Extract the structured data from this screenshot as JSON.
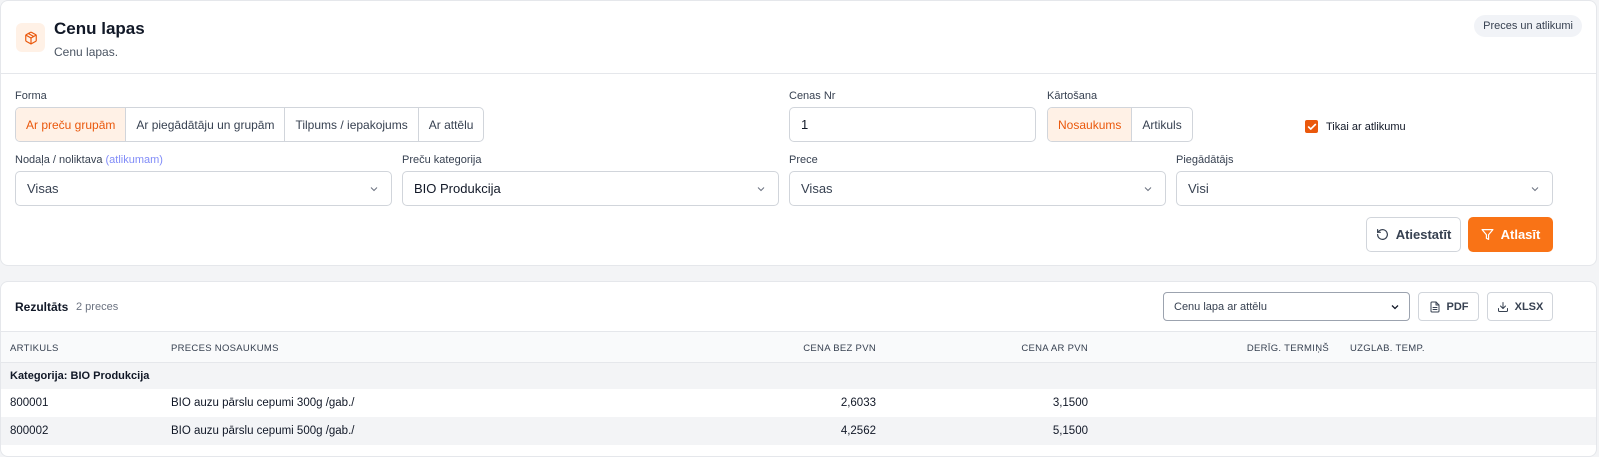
{
  "header": {
    "title": "Cenu lapas",
    "subtitle": "Cenu lapas.",
    "badge": "Preces un atlikumi",
    "icon": "package-icon"
  },
  "filters": {
    "forma": {
      "label": "Forma",
      "options": [
        "Ar preču grupām",
        "Ar piegādātāju un grupām",
        "Tilpums / iepakojums",
        "Ar attēlu"
      ],
      "active_index": 0
    },
    "cenas_nr": {
      "label": "Cenas Nr",
      "value": "1"
    },
    "kartosana": {
      "label": "Kārtošana",
      "options": [
        "Nosaukums",
        "Artikuls"
      ],
      "active_index": 0
    },
    "only_with_stock": {
      "label": "Tikai ar atlikumu",
      "checked": true
    },
    "nodala": {
      "label": "Nodaļa / noliktava",
      "label_hint": "(atlikumam)",
      "value": "Visas"
    },
    "kategorija": {
      "label": "Preču kategorija",
      "value": "BIO Produkcija"
    },
    "prece": {
      "label": "Prece",
      "value": "Visas"
    },
    "piegadatajs": {
      "label": "Piegādātājs",
      "value": "Visi"
    },
    "reset_label": "Atiestatīt",
    "search_label": "Atlasīt"
  },
  "results": {
    "title": "Rezultāts",
    "count": "2 preces",
    "export_format": "Cenu lapa ar attēlu",
    "pdf_label": "PDF",
    "xlsx_label": "XLSX",
    "columns": {
      "artikuls": "ARTIKULS",
      "nosaukums": "PRECES NOSAUKUMS",
      "cena_bez": "CENA BEZ PVN",
      "cena_ar": "CENA AR PVN",
      "termins": "DERĪG. TERMIŅŠ",
      "temp": "UZGLAB. TEMP."
    },
    "group_label": "Kategorija: BIO Produkcija",
    "rows": [
      {
        "artikuls": "800001",
        "nosaukums": "BIO auzu pārslu cepumi 300g /gab./",
        "cena_bez": "2,6033",
        "cena_ar": "3,1500"
      },
      {
        "artikuls": "800002",
        "nosaukums": "BIO auzu pārslu cepumi 500g /gab./",
        "cena_bez": "4,2562",
        "cena_ar": "5,1500"
      }
    ]
  },
  "colors": {
    "accent": "#f97316",
    "accent_light": "#fff1e6"
  }
}
